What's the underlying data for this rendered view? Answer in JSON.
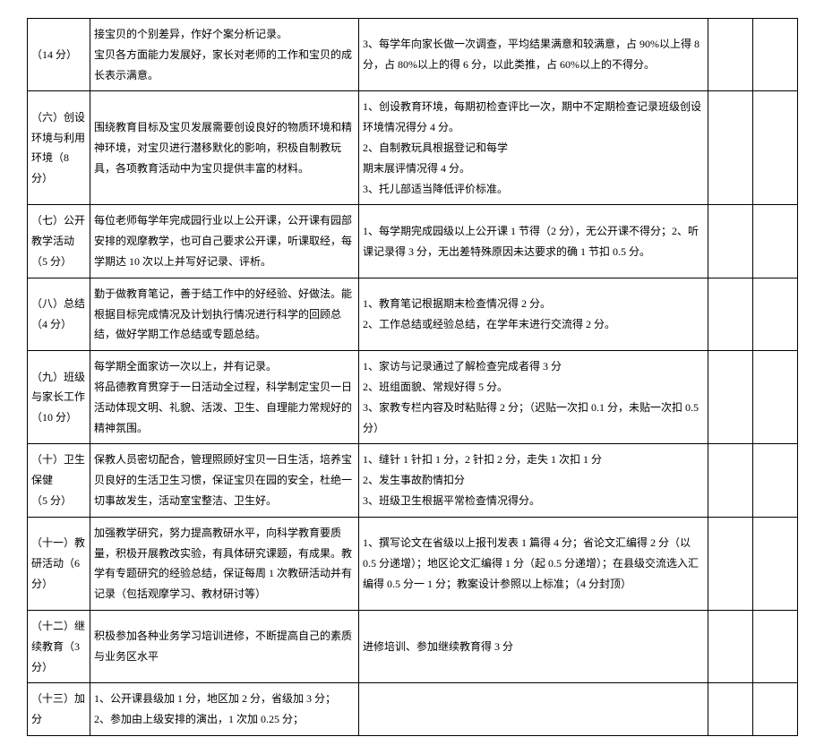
{
  "rows": [
    {
      "label": "（14 分）",
      "desc": "接宝贝的个别差异，作好个案分析记录。\n宝贝各方面能力发展好，家长对老师的工作和宝贝的成长表示满意。",
      "criteria": "3、每学年向家长做一次调查，平均结果满意和较满意，占 90%以上得 8 分，占 80%以上的得 6 分，以此类推，占 60%以上的不得分。"
    },
    {
      "label": "（六）创设环境与利用环境（8 分）",
      "desc": "围绕教育目标及宝贝发展需要创设良好的物质环境和精神环境，对宝贝进行潜移默化的影响，积极自制教玩具，各项教育活动中为宝贝提供丰富的材料。",
      "criteria": "1、创设教育环境，每期初检查评比一次，期中不定期检查记录班级创设环境情况得分 4 分。\n2、自制教玩具根据登记和每学\n期末展评情况得 4 分。\n3、托儿部适当降低评价标准。"
    },
    {
      "label": "（七）公开教学活动\n（5 分）",
      "desc": "每位老师每学年完成园行业以上公开课，公开课有园部安排的观摩教学，也可自己要求公开课，听课取经，每学期达 10 次以上并写好记录、评析。",
      "criteria": "1、每学期完成园级以上公开课 1 节得（2 分），无公开课不得分；2、听课记录得 3 分，无出差特殊原因未达要求的确 1 节扣 0.5 分。"
    },
    {
      "label": "（八）总结\n（4 分）",
      "desc": "勤于做教育笔记，善于结工作中的好经验、好做法。能根据目标完成情况及计划执行情况进行科学的回顾总结，做好学期工作总结或专题总结。",
      "criteria": "1、教育笔记根据期末检查情况得 2 分。\n2、工作总结或经验总结，在学年末进行交流得 2 分。"
    },
    {
      "label": "（九）班级与家长工作\n（10 分）",
      "desc": "每学期全面家访一次以上，并有记录。\n将品德教育贯穿于一日活动全过程，科学制定宝贝一日活动体现文明、礼貌、活泼、卫生、自理能力常规好的精神氛围。",
      "criteria": "1、家访与记录通过了解检查完成者得 3 分\n2、班组面貌、常规好得 5 分。\n3、家教专栏内容及时粘贴得 2 分；（迟贴一次扣 0.1 分，未贴一次扣 0.5 分）"
    },
    {
      "label": "（十）卫生保健\n（5 分）",
      "desc": "保教人员密切配合，管理照顾好宝贝一日生活，培养宝贝良好的生活卫生习惯，保证宝贝在园的安全，杜绝一切事故发生，活动室宝整洁、卫生好。",
      "criteria": "1、缝针 1 针扣 1 分，2 针扣 2 分，走失 1 次扣 1 分\n2、发生事故酌情扣分\n3、班级卫生根据平常检查情况得分。"
    },
    {
      "label": "（十一）教研活动（6分）",
      "desc": "加强教学研究，努力提高教研水平，向科学教育要质量，积极开展教改实验，有具体研究课题，有成果。教学有专题研究的经验总结，保证每周 1 次教研活动并有记录（包括观摩学习、教材研讨等）",
      "criteria": "1、撰写论文在省级以上报刊发表 1 篇得 4 分；省论文汇编得 2 分（以 0.5 分递增）；地区论文汇编得 1 分（起 0.5 分递增）；在县级交流选入汇编得 0.5 分一 1 分；教案设计参照以上标准；（4 分封顶）"
    },
    {
      "label": "（十二）继续教育（3分）",
      "desc": "积极参加各种业务学习培训进修，不断提高自己的素质与业务区水平",
      "criteria": "进修培训、参加继续教育得 3 分"
    },
    {
      "label": "（十三）加分",
      "desc": "1、公开课县级加 1 分，地区加 2 分，省级加 3 分；\n2、参加由上级安排的演出，1 次加 0.25 分；",
      "criteria": ""
    }
  ]
}
